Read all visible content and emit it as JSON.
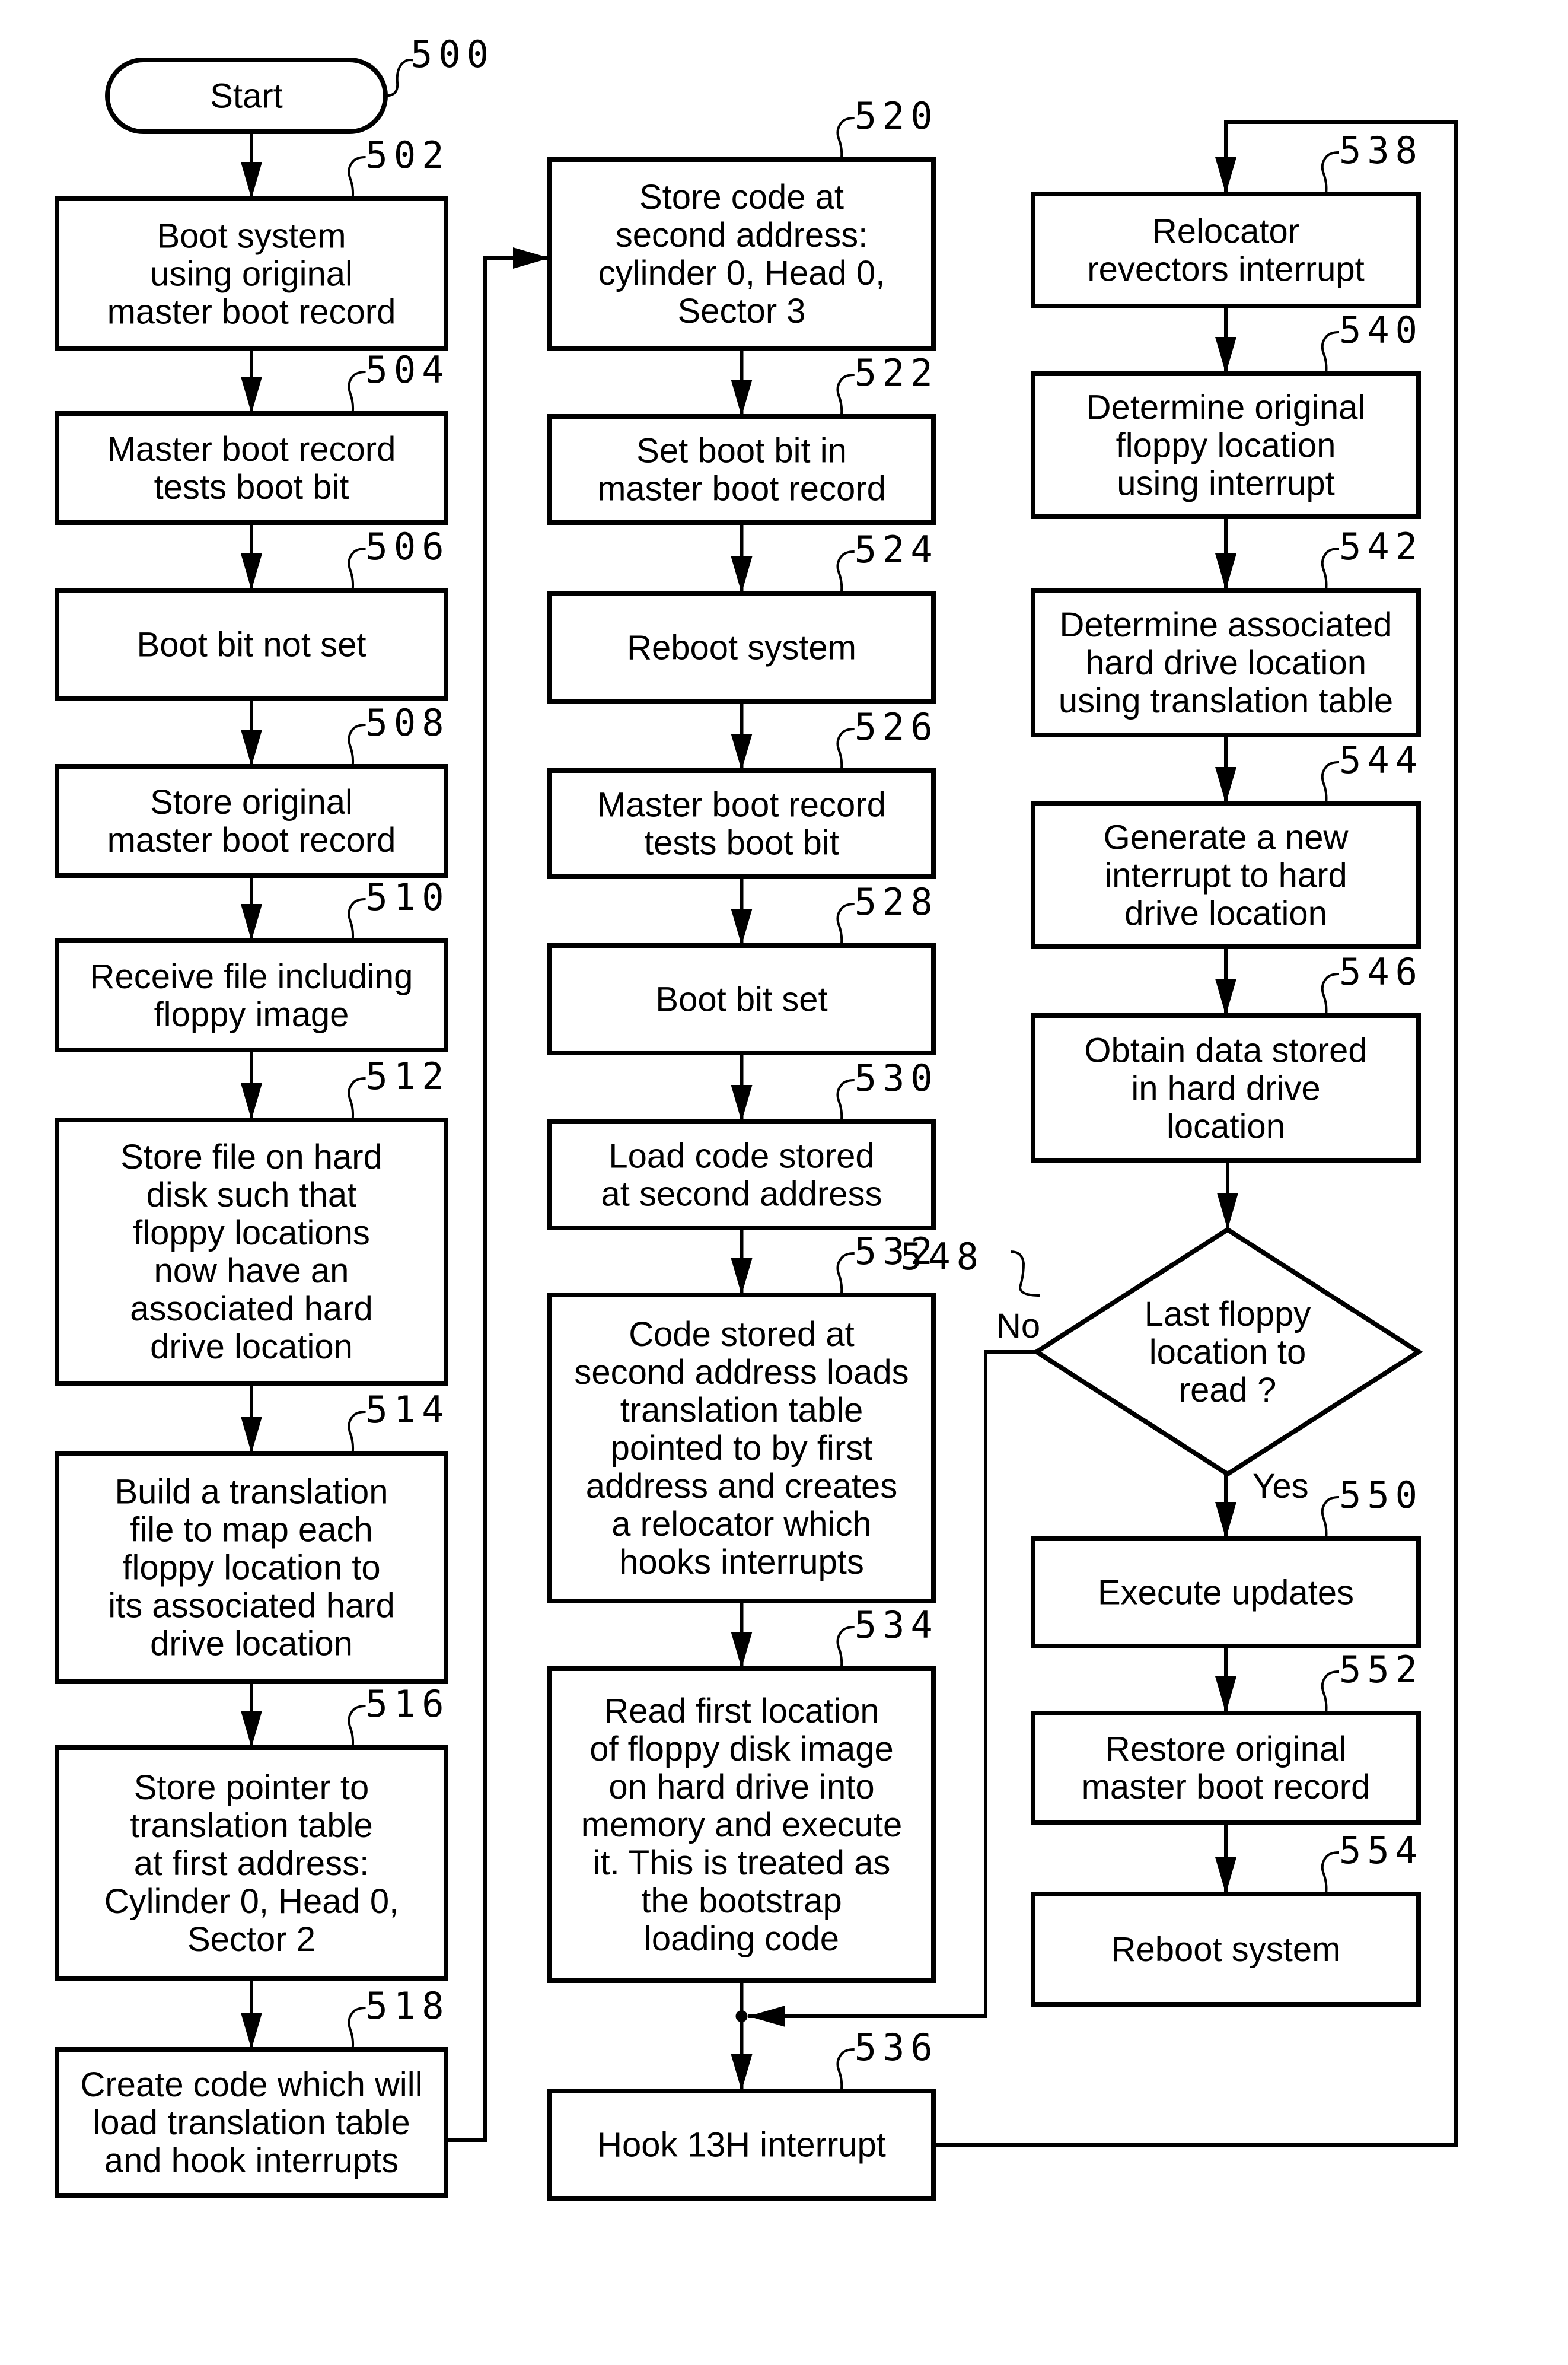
{
  "diagram": {
    "type": "flowchart",
    "nodes": [
      {
        "id": "500",
        "shape": "terminator",
        "lines": [
          "Start"
        ]
      },
      {
        "id": "502",
        "shape": "process",
        "lines": [
          "Boot system",
          "using original",
          "master boot record"
        ]
      },
      {
        "id": "504",
        "shape": "process",
        "lines": [
          "Master boot record",
          "tests boot bit"
        ]
      },
      {
        "id": "506",
        "shape": "process",
        "lines": [
          "Boot bit not set"
        ]
      },
      {
        "id": "508",
        "shape": "process",
        "lines": [
          "Store original",
          "master boot record"
        ]
      },
      {
        "id": "510",
        "shape": "process",
        "lines": [
          "Receive file including",
          "floppy image"
        ]
      },
      {
        "id": "512",
        "shape": "process",
        "lines": [
          "Store file on hard",
          "disk such that",
          "floppy locations",
          "now have an",
          "associated hard",
          "drive location"
        ]
      },
      {
        "id": "514",
        "shape": "process",
        "lines": [
          "Build a translation",
          "file to map each",
          "floppy location to",
          "its associated hard",
          "drive location"
        ]
      },
      {
        "id": "516",
        "shape": "process",
        "lines": [
          "Store pointer to",
          "translation table",
          "at first address:",
          "Cylinder 0, Head 0,",
          "Sector 2"
        ]
      },
      {
        "id": "518",
        "shape": "process",
        "lines": [
          "Create code which will",
          "load translation table",
          "and hook interrupts"
        ]
      },
      {
        "id": "520",
        "shape": "process",
        "lines": [
          "Store code at",
          "second address:",
          "cylinder 0, Head 0,",
          "Sector 3"
        ]
      },
      {
        "id": "522",
        "shape": "process",
        "lines": [
          "Set boot bit in",
          "master boot record"
        ]
      },
      {
        "id": "524",
        "shape": "process",
        "lines": [
          "Reboot system"
        ]
      },
      {
        "id": "526",
        "shape": "process",
        "lines": [
          "Master boot record",
          "tests boot bit"
        ]
      },
      {
        "id": "528",
        "shape": "process",
        "lines": [
          "Boot bit set"
        ]
      },
      {
        "id": "530",
        "shape": "process",
        "lines": [
          "Load code stored",
          "at second address"
        ]
      },
      {
        "id": "532",
        "shape": "process",
        "lines": [
          "Code stored at",
          "second address loads",
          "translation table",
          "pointed to by first",
          "address and creates",
          "a relocator which",
          "hooks interrupts"
        ]
      },
      {
        "id": "534",
        "shape": "process",
        "lines": [
          "Read first location",
          "of floppy disk image",
          "on hard drive into",
          "memory and execute",
          "it. This is treated as",
          "the bootstrap",
          "loading code"
        ]
      },
      {
        "id": "536",
        "shape": "process",
        "lines": [
          "Hook 13H interrupt"
        ]
      },
      {
        "id": "538",
        "shape": "process",
        "lines": [
          "Relocator",
          "revectors interrupt"
        ]
      },
      {
        "id": "540",
        "shape": "process",
        "lines": [
          "Determine original",
          "floppy location",
          "using interrupt"
        ]
      },
      {
        "id": "542",
        "shape": "process",
        "lines": [
          "Determine associated",
          "hard drive location",
          "using translation table"
        ]
      },
      {
        "id": "544",
        "shape": "process",
        "lines": [
          "Generate a new",
          "interrupt to hard",
          "drive location"
        ]
      },
      {
        "id": "546",
        "shape": "process",
        "lines": [
          "Obtain data stored",
          "in hard drive",
          "location"
        ]
      },
      {
        "id": "548",
        "shape": "decision",
        "lines": [
          "Last floppy",
          "location to",
          "read ?"
        ]
      },
      {
        "id": "550",
        "shape": "process",
        "lines": [
          "Execute updates"
        ]
      },
      {
        "id": "552",
        "shape": "process",
        "lines": [
          "Restore original",
          "master boot record"
        ]
      },
      {
        "id": "554",
        "shape": "process",
        "lines": [
          "Reboot system"
        ]
      }
    ],
    "edges": [
      {
        "from": "500",
        "to": "502"
      },
      {
        "from": "502",
        "to": "504"
      },
      {
        "from": "504",
        "to": "506"
      },
      {
        "from": "506",
        "to": "508"
      },
      {
        "from": "508",
        "to": "510"
      },
      {
        "from": "510",
        "to": "512"
      },
      {
        "from": "512",
        "to": "514"
      },
      {
        "from": "514",
        "to": "516"
      },
      {
        "from": "516",
        "to": "518"
      },
      {
        "from": "518",
        "to": "520"
      },
      {
        "from": "520",
        "to": "522"
      },
      {
        "from": "522",
        "to": "524"
      },
      {
        "from": "524",
        "to": "526"
      },
      {
        "from": "526",
        "to": "528"
      },
      {
        "from": "528",
        "to": "530"
      },
      {
        "from": "530",
        "to": "532"
      },
      {
        "from": "532",
        "to": "534"
      },
      {
        "from": "534",
        "to": "536"
      },
      {
        "from": "536",
        "to": "538"
      },
      {
        "from": "538",
        "to": "540"
      },
      {
        "from": "540",
        "to": "542"
      },
      {
        "from": "542",
        "to": "544"
      },
      {
        "from": "544",
        "to": "546"
      },
      {
        "from": "546",
        "to": "548"
      },
      {
        "from": "548",
        "to": "550",
        "label": "Yes"
      },
      {
        "from": "548",
        "to": "536",
        "label": "No"
      },
      {
        "from": "550",
        "to": "552"
      },
      {
        "from": "552",
        "to": "554"
      }
    ],
    "branch_labels": {
      "yes": "Yes",
      "no": "No"
    }
  }
}
